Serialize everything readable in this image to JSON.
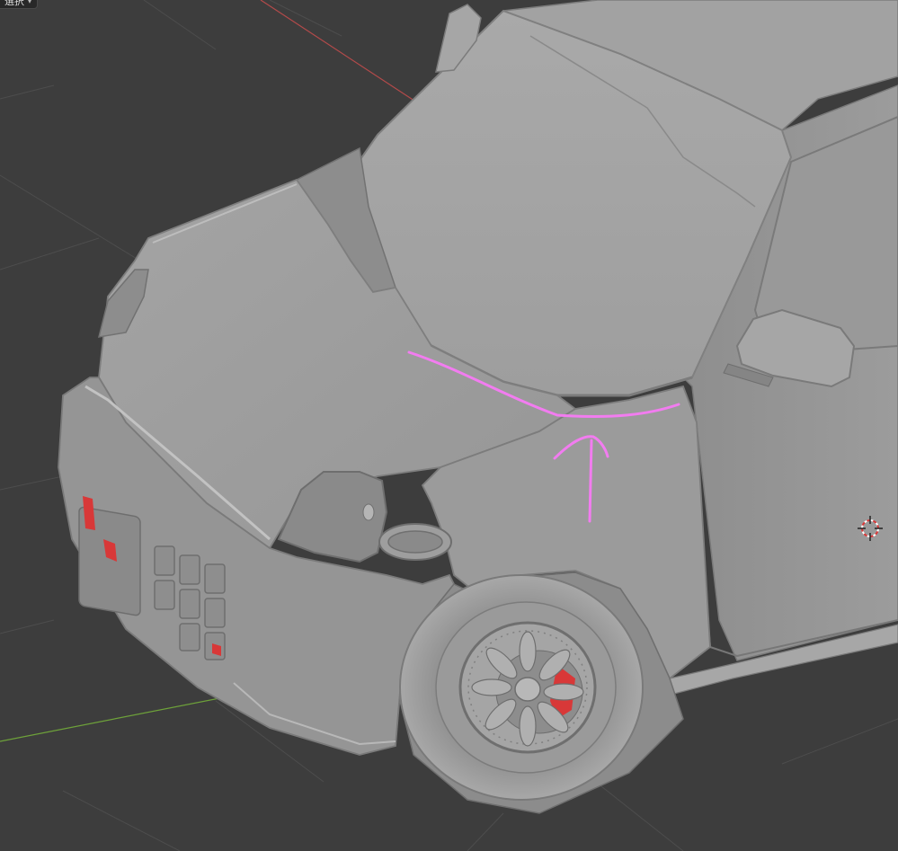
{
  "app": {
    "mode_dropdown": {
      "label": "選択",
      "chevron": "chevron-down-icon"
    }
  },
  "viewport": {
    "background_color": "#3d3d3d",
    "grid_color": "#4d4d4d",
    "x_axis_color": "#b34a4a",
    "y_axis_color": "#6ea23a",
    "model_color": "#9a9a9a",
    "annotation_color": "#f27cf0",
    "annotation": {
      "shape": "curve-with-up-arrow"
    },
    "gizmo": {
      "icon": "3d-cursor-icon"
    }
  }
}
